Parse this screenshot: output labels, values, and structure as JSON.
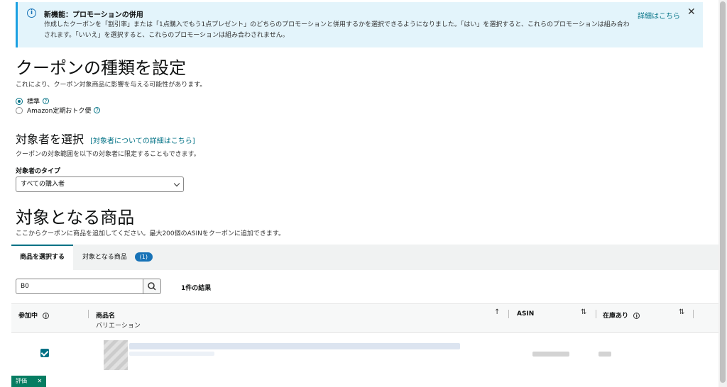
{
  "banner": {
    "title": "新機能：プロモーションの併用",
    "text": "作成したクーポンを「割引率」または「1点購入でもう1点プレゼント」のどちらのプロモーションと併用するかを選択できるようになりました。「はい」を選択すると、これらのプロモーションは組み合わされます。「いいえ」を選択すると、これらのプロモーションは組み合わされません。",
    "link": "詳細はこちら",
    "close": "✕"
  },
  "coupon_type": {
    "title": "クーポンの種類を設定",
    "subtitle": "これにより、クーポン対象商品に影響を与える可能性があります。",
    "options": [
      "標準",
      "Amazon定期おトク便"
    ]
  },
  "audience": {
    "title": "対象者を選択",
    "link": "[対象者についての詳細はこちら]",
    "subtitle": "クーポンの対象範囲を以下の対象者に限定することもできます。",
    "type_label": "対象者のタイプ",
    "type_value": "すべての購入者"
  },
  "products": {
    "title": "対象となる商品",
    "subtitle": "ここからクーポンに商品を追加してください。最大200個のASINをクーポンに追加できます。",
    "tabs": [
      "商品を選択する",
      "対象となる商品"
    ],
    "badge": "(1)",
    "search_value": "B0",
    "results": "1件の結果",
    "columns": {
      "participating": "参加中",
      "name": "商品名",
      "variation": "バリエーション",
      "asin": "ASIN",
      "stock": "在庫あり"
    }
  },
  "footer": {
    "tag": "評価",
    "close": "✕"
  }
}
